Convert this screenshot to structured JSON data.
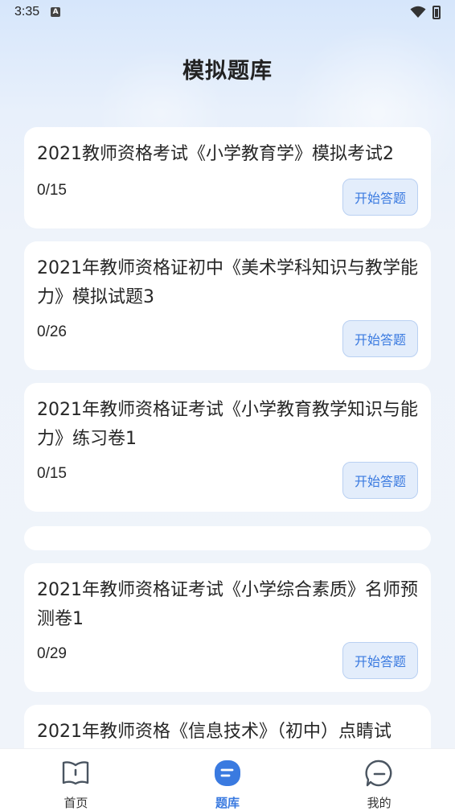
{
  "status_bar": {
    "time": "3:35",
    "indicator": "A"
  },
  "page_title": "模拟题库",
  "cards": [
    {
      "title": "2021教师资格考试《小学教育学》模拟考试2",
      "progress": "0/15",
      "button": "开始答题"
    },
    {
      "title": "2021年教师资格证初中《美术学科知识与教学能力》模拟试题3",
      "progress": "0/26",
      "button": "开始答题"
    },
    {
      "title": "2021年教师资格证考试《小学教育教学知识与能力》练习卷1",
      "progress": "0/15",
      "button": "开始答题"
    },
    {
      "title": "",
      "progress": "",
      "button": ""
    },
    {
      "title": "2021年教师资格证考试《小学综合素质》名师预测卷1",
      "progress": "0/29",
      "button": "开始答题"
    },
    {
      "title": "2021年教师资格《信息技术》（初中）点睛试",
      "progress": "",
      "button": ""
    }
  ],
  "tabs": [
    {
      "label": "首页",
      "icon": "book-icon",
      "active": false
    },
    {
      "label": "题库",
      "icon": "question-bank-icon",
      "active": true
    },
    {
      "label": "我的",
      "icon": "chat-bubble-icon",
      "active": false
    }
  ],
  "colors": {
    "accent": "#3a7ae0",
    "button_bg": "#e3edfb",
    "card_bg": "#ffffff"
  }
}
